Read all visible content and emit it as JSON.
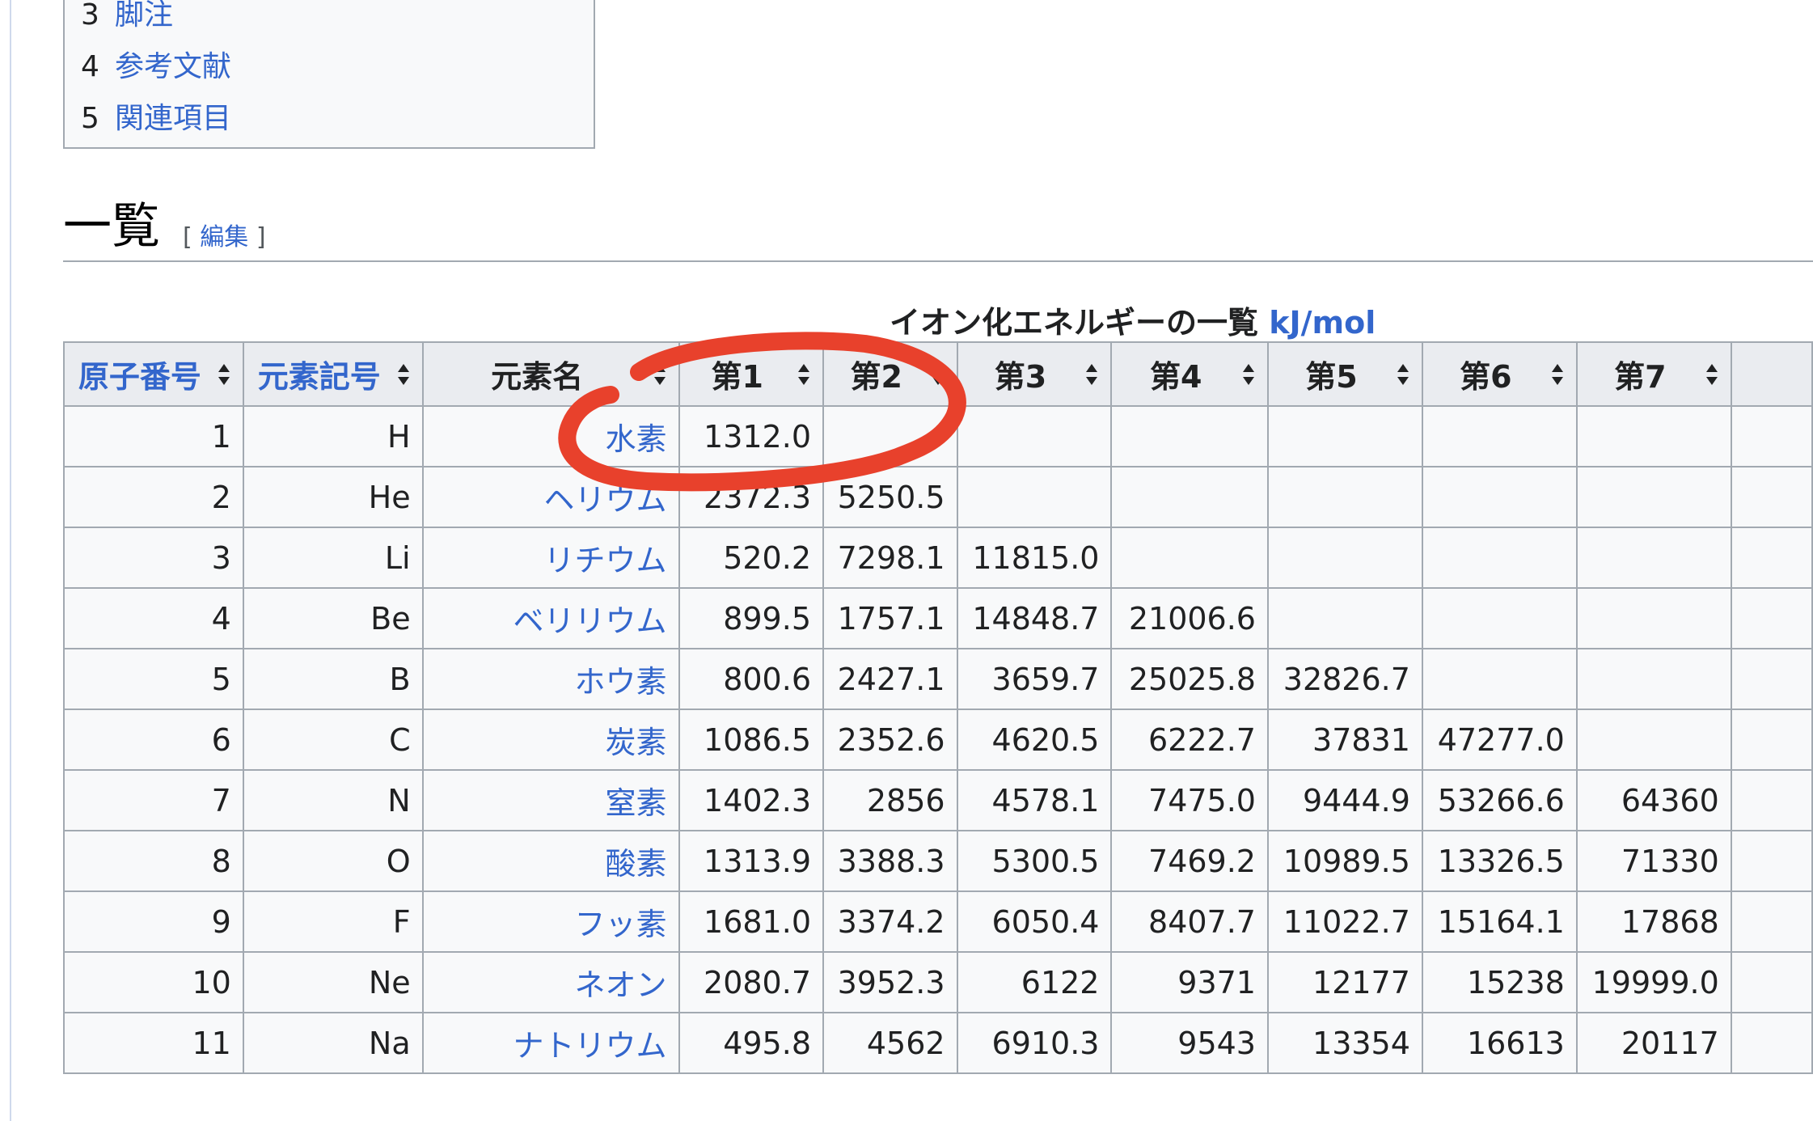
{
  "toc": {
    "items": [
      {
        "num": "3",
        "label": "脚注"
      },
      {
        "num": "4",
        "label": "参考文献"
      },
      {
        "num": "5",
        "label": "関連項目"
      }
    ]
  },
  "section": {
    "title": "一覧",
    "edit_open": "[",
    "edit_label": "編集",
    "edit_close": "]"
  },
  "table": {
    "caption": "イオン化エネルギーの一覧",
    "caption_unit": "kJ/mol",
    "headers": [
      "原子番号",
      "元素記号",
      "元素名",
      "第1",
      "第2",
      "第3",
      "第4",
      "第5",
      "第6",
      "第7"
    ],
    "rows": [
      [
        "1",
        "H",
        "水素",
        "1312.0",
        "",
        "",
        "",
        "",
        "",
        ""
      ],
      [
        "2",
        "He",
        "ヘリウム",
        "2372.3",
        "5250.5",
        "",
        "",
        "",
        "",
        ""
      ],
      [
        "3",
        "Li",
        "リチウム",
        "520.2",
        "7298.1",
        "11815.0",
        "",
        "",
        "",
        ""
      ],
      [
        "4",
        "Be",
        "ベリリウム",
        "899.5",
        "1757.1",
        "14848.7",
        "21006.6",
        "",
        "",
        ""
      ],
      [
        "5",
        "B",
        "ホウ素",
        "800.6",
        "2427.1",
        "3659.7",
        "25025.8",
        "32826.7",
        "",
        ""
      ],
      [
        "6",
        "C",
        "炭素",
        "1086.5",
        "2352.6",
        "4620.5",
        "6222.7",
        "37831",
        "47277.0",
        ""
      ],
      [
        "7",
        "N",
        "窒素",
        "1402.3",
        "2856",
        "4578.1",
        "7475.0",
        "9444.9",
        "53266.6",
        "64360"
      ],
      [
        "8",
        "O",
        "酸素",
        "1313.9",
        "3388.3",
        "5300.5",
        "7469.2",
        "10989.5",
        "13326.5",
        "71330"
      ],
      [
        "9",
        "F",
        "フッ素",
        "1681.0",
        "3374.2",
        "6050.4",
        "8407.7",
        "11022.7",
        "15164.1",
        "17868"
      ],
      [
        "10",
        "Ne",
        "ネオン",
        "2080.7",
        "3952.3",
        "6122",
        "9371",
        "12177",
        "15238",
        "19999.0"
      ],
      [
        "11",
        "Na",
        "ナトリウム",
        "495.8",
        "4562",
        "6910.3",
        "9543",
        "13354",
        "16613",
        "20117"
      ]
    ]
  },
  "colors": {
    "link": "#3366cc",
    "header_bg": "#eaecf0",
    "cell_bg": "#f8f9fa",
    "border": "#a2a9b1",
    "annotation": "#e8412c"
  }
}
